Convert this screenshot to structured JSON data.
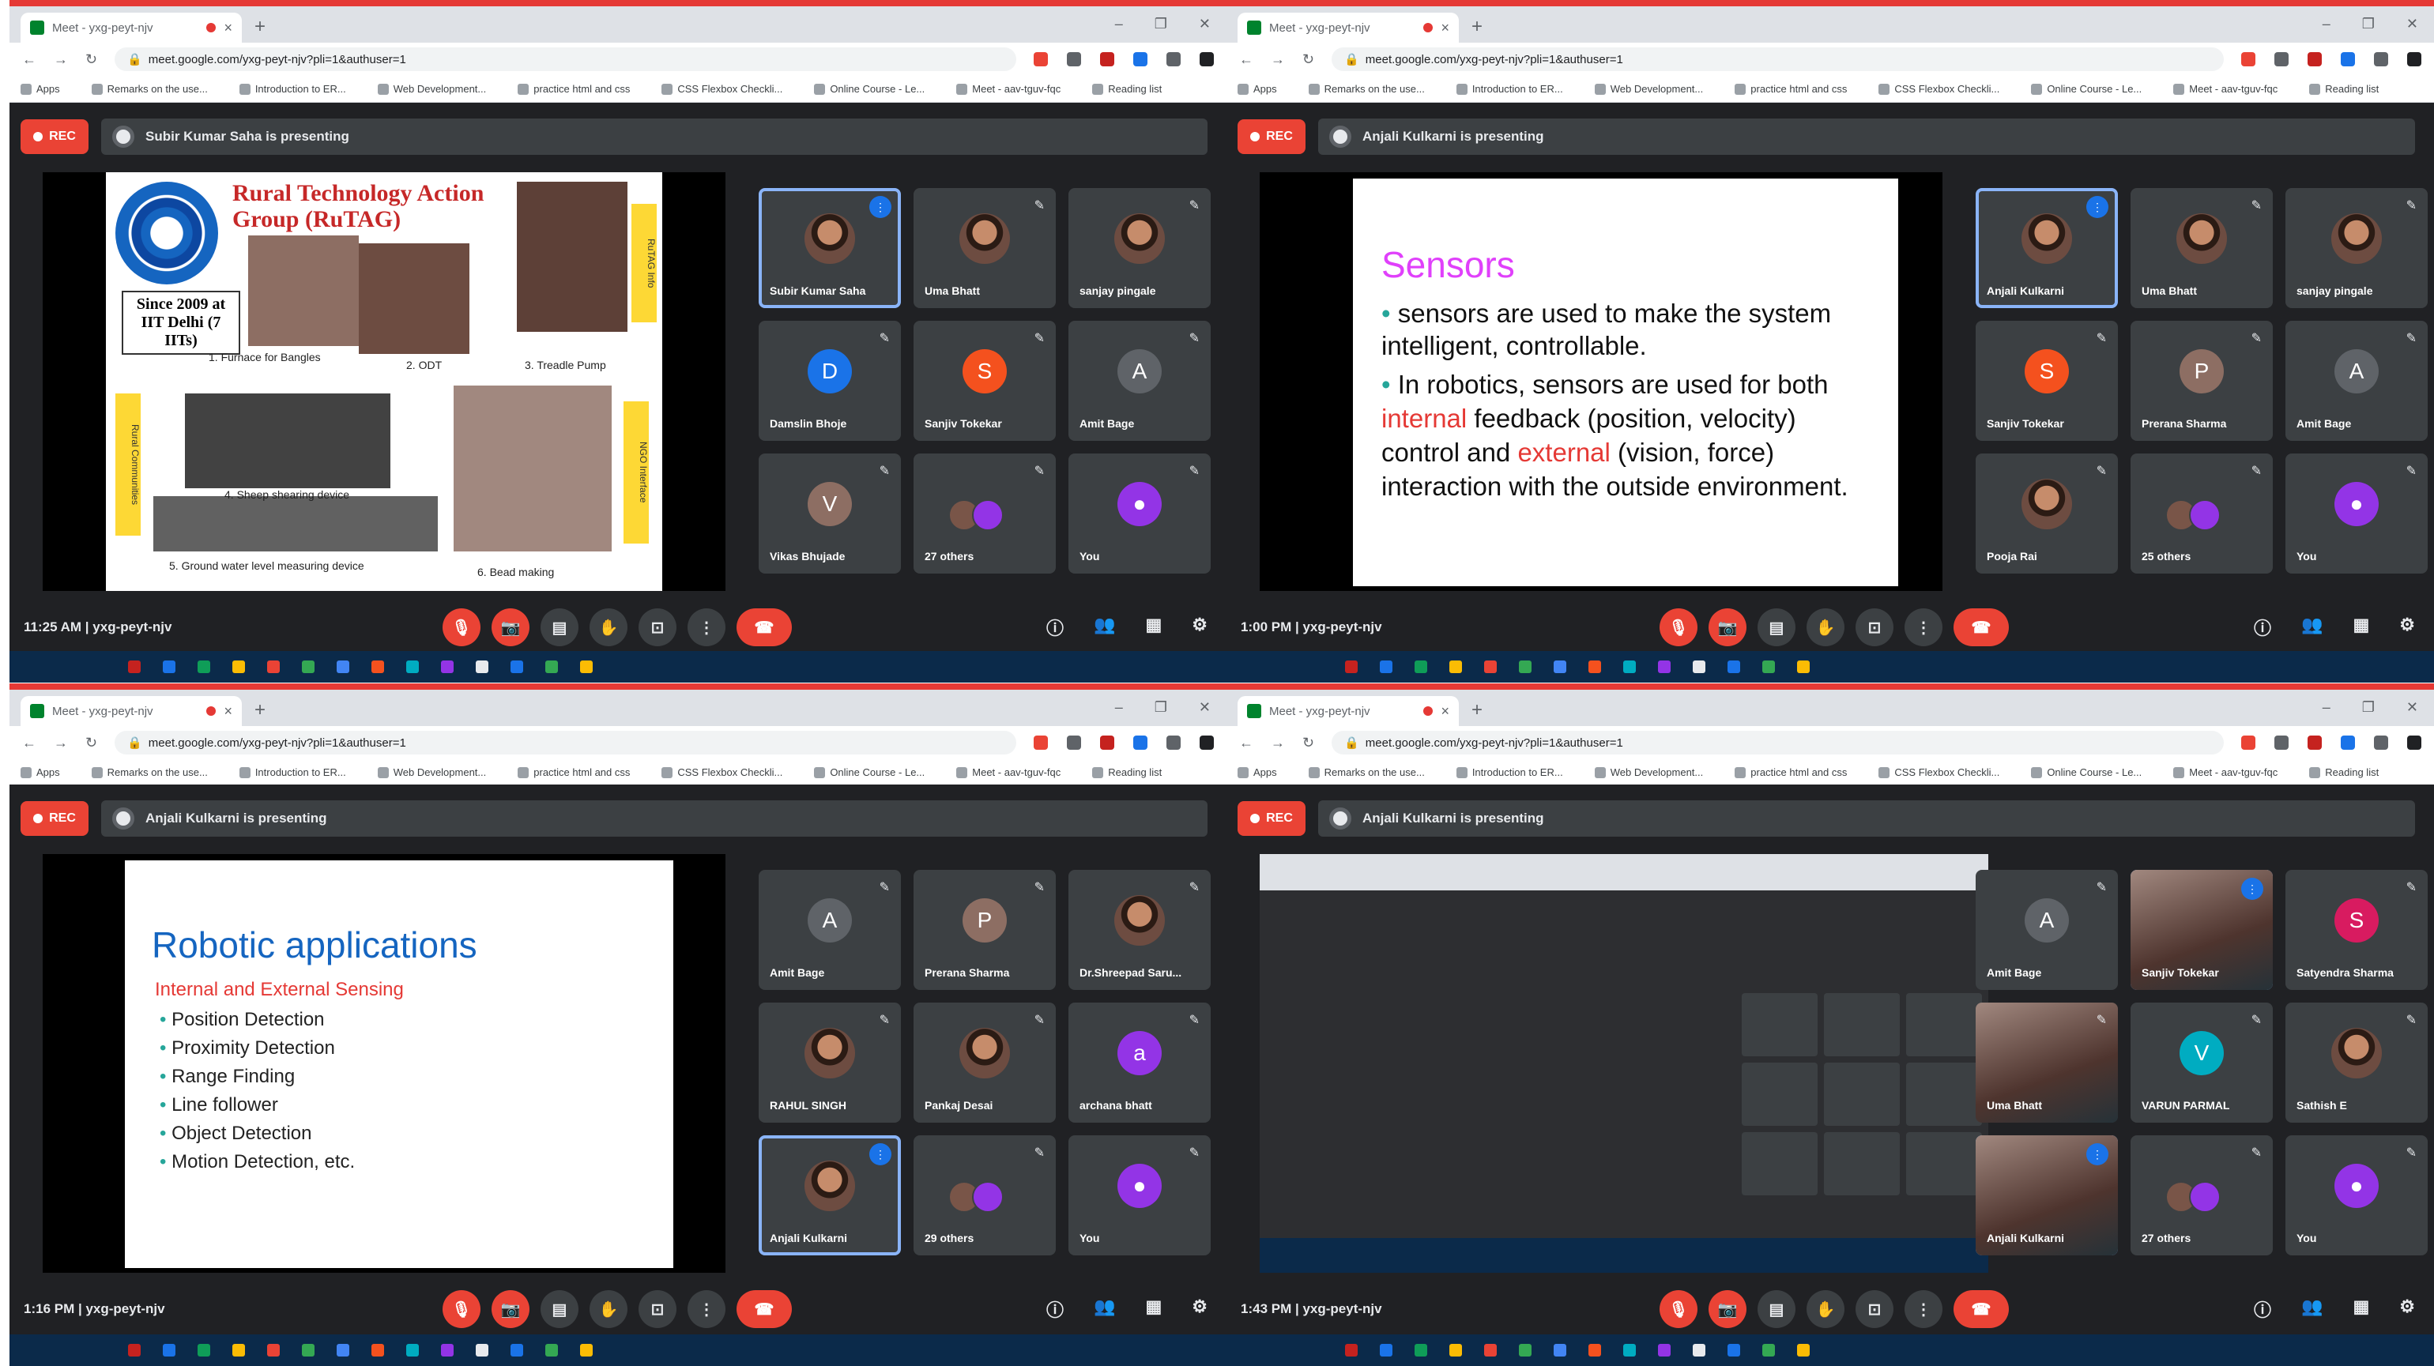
{
  "panels": [
    {
      "tab_title": "Meet - yxg-peyt-njv",
      "url": "meet.google.com/yxg-peyt-njv?pli=1&authuser=1",
      "presenter_text": "Subir Kumar Saha is presenting",
      "rec_label": "REC",
      "time": "11:25 AM",
      "meeting_code": "yxg-peyt-njv",
      "slide": {
        "title": "Rural Technology Action Group (RuTAG)",
        "since": "Since 2009 at IIT Delhi (7 IITs)",
        "captions": [
          "1. Furnace for Bangles",
          "2. ODT",
          "3. Treadle Pump",
          "4. Sheep shearing device",
          "5. Ground water level measuring device",
          "6. Bead making"
        ],
        "side_a": "RuTAG Info",
        "side_b": "Rural Communities",
        "side_c": "NGO Interface"
      },
      "tiles": [
        {
          "name": "Subir Kumar Saha",
          "type": "photo",
          "speaking": true
        },
        {
          "name": "Uma Bhatt",
          "type": "photo"
        },
        {
          "name": "sanjay pingale",
          "type": "photo"
        },
        {
          "name": "Damslin Bhoje",
          "initial": "D",
          "color": "#1a73e8"
        },
        {
          "name": "Sanjiv Tokekar",
          "initial": "S",
          "color": "#f4511e"
        },
        {
          "name": "Amit Bage",
          "initial": "A",
          "color": "#5f6368"
        },
        {
          "name": "Vikas Bhujade",
          "initial": "V",
          "color": "#8d6e63"
        },
        {
          "name": "27 others",
          "type": "group"
        },
        {
          "name": "You",
          "initial": "",
          "color": "#9334e6"
        }
      ]
    },
    {
      "tab_title": "Meet - yxg-peyt-njv",
      "url": "meet.google.com/yxg-peyt-njv?pli=1&authuser=1",
      "presenter_text": "Anjali Kulkarni is presenting",
      "rec_label": "REC",
      "time": "1:00 PM",
      "meeting_code": "yxg-peyt-njv",
      "slide": {
        "title": "Sensors",
        "b1": "sensors are used to make the system intelligent, controllable.",
        "b2_pre": "In robotics, sensors are used for both ",
        "b2_internal": "internal",
        "b2_mid": " feedback (position, velocity) control and ",
        "b2_external": "external",
        "b2_post": " (vision, force) interaction with the outside environment."
      },
      "tiles": [
        {
          "name": "Anjali Kulkarni",
          "type": "photo",
          "speaking": true
        },
        {
          "name": "Uma Bhatt",
          "type": "photo"
        },
        {
          "name": "sanjay pingale",
          "type": "photo"
        },
        {
          "name": "Sanjiv Tokekar",
          "initial": "S",
          "color": "#f4511e"
        },
        {
          "name": "Prerana Sharma",
          "initial": "P",
          "color": "#8d6e63"
        },
        {
          "name": "Amit Bage",
          "initial": "A",
          "color": "#5f6368"
        },
        {
          "name": "Pooja Rai",
          "type": "photo"
        },
        {
          "name": "25 others",
          "type": "group"
        },
        {
          "name": "You",
          "initial": "",
          "color": "#9334e6"
        }
      ]
    },
    {
      "tab_title": "Meet - yxg-peyt-njv",
      "url": "meet.google.com/yxg-peyt-njv?pli=1&authuser=1",
      "presenter_text": "Anjali Kulkarni is presenting",
      "rec_label": "REC",
      "time": "1:16 PM",
      "meeting_code": "yxg-peyt-njv",
      "slide": {
        "title": "Robotic applications",
        "subtitle": "Internal and External Sensing",
        "items": [
          "Position Detection",
          "Proximity Detection",
          "Range Finding",
          "Line follower",
          "Object Detection",
          "Motion Detection, etc."
        ]
      },
      "tiles": [
        {
          "name": "Amit Bage",
          "initial": "A",
          "color": "#5f6368"
        },
        {
          "name": "Prerana Sharma",
          "initial": "P",
          "color": "#8d6e63"
        },
        {
          "name": "Dr.Shreepad Saru...",
          "type": "photo"
        },
        {
          "name": "RAHUL SINGH",
          "type": "photo"
        },
        {
          "name": "Pankaj Desai",
          "type": "photo"
        },
        {
          "name": "archana bhatt",
          "initial": "a",
          "color": "#9334e6"
        },
        {
          "name": "Anjali Kulkarni",
          "type": "photo",
          "speaking": true
        },
        {
          "name": "29 others",
          "type": "group"
        },
        {
          "name": "You",
          "initial": "",
          "color": "#9334e6"
        }
      ]
    },
    {
      "tab_title": "Meet - yxg-peyt-njv",
      "url": "meet.google.com/yxg-peyt-njv?pli=1&authuser=1",
      "presenter_text": "Anjali Kulkarni is presenting",
      "rec_label": "REC",
      "time": "1:43 PM",
      "meeting_code": "yxg-peyt-njv",
      "tiles": [
        {
          "name": "Amit Bage",
          "initial": "A",
          "color": "#5f6368"
        },
        {
          "name": "Sanjiv Tokekar",
          "type": "video",
          "speaking": true
        },
        {
          "name": "Satyendra Sharma",
          "initial": "S",
          "color": "#d81b60"
        },
        {
          "name": "Uma Bhatt",
          "type": "video"
        },
        {
          "name": "VARUN PARMAL",
          "initial": "V",
          "color": "#00acc1"
        },
        {
          "name": "Sathish E",
          "type": "photo"
        },
        {
          "name": "Anjali Kulkarni",
          "type": "video",
          "speaking": true
        },
        {
          "name": "27 others",
          "type": "group"
        },
        {
          "name": "You",
          "initial": "",
          "color": "#9334e6"
        }
      ]
    }
  ],
  "bookmarks": [
    "Apps",
    "Remarks on the use...",
    "Introduction to ER...",
    "Web Development...",
    "practice html and css",
    "CSS Flexbox Checkli...",
    "Online Course - Le...",
    "Meet - aav-tguv-fqc",
    "Reading list"
  ],
  "colors": {
    "meet_bg": "#202124",
    "tile_bg": "#3c4043",
    "rec": "#ea4335",
    "accent": "#8ab4f8",
    "taskbar": "#0b2a4a"
  }
}
